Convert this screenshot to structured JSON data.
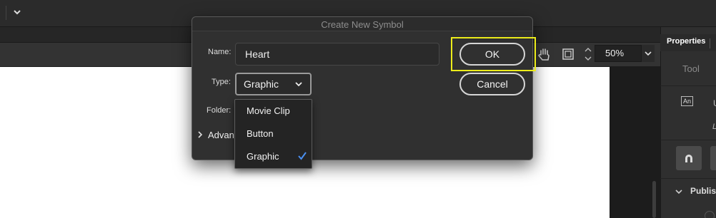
{
  "dialog": {
    "title": "Create New Symbol",
    "name_label": "Name:",
    "name_value": "Heart",
    "type_label": "Type:",
    "type_value": "Graphic",
    "folder_label": "Folder:",
    "advanced_label": "Advanced",
    "ok_label": "OK",
    "cancel_label": "Cancel"
  },
  "type_dropdown": {
    "options": [
      "Movie Clip",
      "Button",
      "Graphic"
    ],
    "selected": "Graphic"
  },
  "toolbar": {
    "zoom": "50%"
  },
  "properties_panel": {
    "tab": "Properties",
    "tool_label": "Tool",
    "an_badge": "An",
    "u_fragment": "U",
    "l_fragment": "L",
    "publish_label": "Publis"
  },
  "colors": {
    "focus_ring": "#ecec1a",
    "checkmark": "#4a8ff0",
    "dialog_bg": "#303030"
  }
}
